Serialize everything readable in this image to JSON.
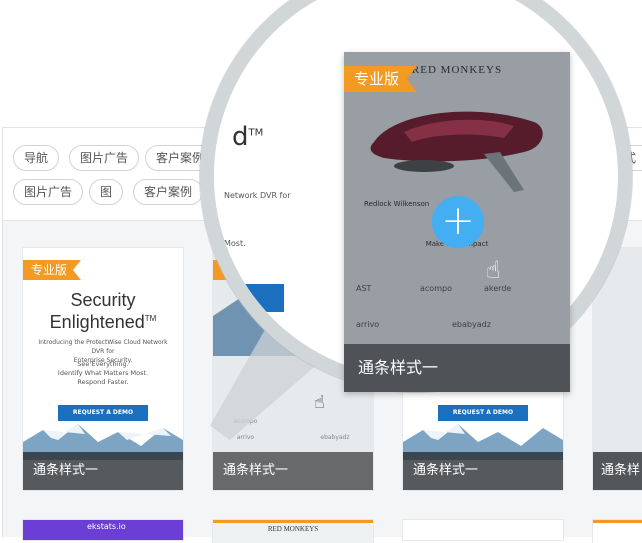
{
  "tags_row1": [
    "导航",
    "图片广告",
    "客户案例"
  ],
  "tags_row2": [
    "图片广告",
    "图",
    "客户案例"
  ],
  "tag_partial_right": "应式",
  "badge_label": "专业版",
  "card1": {
    "title_line1": "Security",
    "title_line2": "Enlightened",
    "tm": "TM",
    "desc1": "Introducing the ProtectWise Cloud Network DVR for",
    "desc2": "Enterprise Security.",
    "tag1": "See Everything.",
    "tag2": "Identify What Matters Most.",
    "tag3": "Respond Faster.",
    "button": "REQUEST A DEMO",
    "caption": "通条样式一"
  },
  "card2": {
    "caption": "通条样式一",
    "logo1": "arrivo",
    "logo2": "ebabyadz",
    "logo3": "acompo"
  },
  "card3": {
    "caption": "通条样式一",
    "button": "REQUEST A DEMO"
  },
  "card4": {
    "caption": "通条样"
  },
  "lens": {
    "frag_d": "d",
    "frag_tm": "TM",
    "frag_line1": "Network DVR for",
    "frag_line2": "Most.",
    "big_brand": "RED MONKEYS",
    "big_caption": "通条样式一",
    "big_logos": [
      "AST",
      "acompo",
      "akerde",
      "arrivo",
      "ebabyadz"
    ],
    "big_sub": "Redlock Wilkenson",
    "big_sub2": "Make it an impact"
  },
  "row2": {
    "brand_partial": "RED MONKEYS",
    "purple_text": "ekstats.io"
  },
  "colors": {
    "accent": "#44aef2",
    "badge": "#f39a22",
    "demo": "#1b6fbf"
  }
}
